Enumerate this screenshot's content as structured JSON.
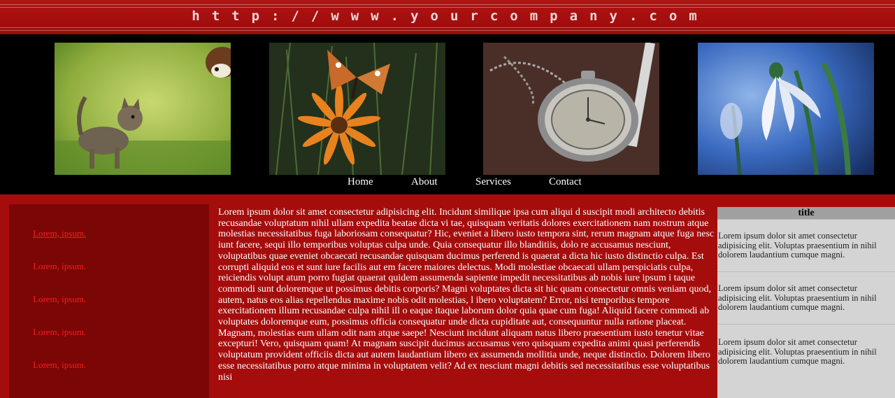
{
  "header": {
    "url_text": "http://www.yourcompany.com"
  },
  "gallery": {
    "images": [
      {
        "icon": "kitten-and-puppy-photo"
      },
      {
        "icon": "butterfly-on-flower-photo"
      },
      {
        "icon": "pocket-watch-photo"
      },
      {
        "icon": "snowdrop-flower-photo"
      }
    ]
  },
  "nav": {
    "items": [
      {
        "label": "Home"
      },
      {
        "label": "About"
      },
      {
        "label": "Services"
      },
      {
        "label": "Contact"
      }
    ]
  },
  "sidebar": {
    "links": [
      {
        "label": "Lorem, ipsum."
      },
      {
        "label": "Lorem, ipsum."
      },
      {
        "label": "Lorem, ipsum."
      },
      {
        "label": "Lorem, ipsum."
      },
      {
        "label": "Lorem, ipsum."
      }
    ]
  },
  "main": {
    "body": "Lorem ipsum dolor sit amet consectetur adipisicing elit. Incidunt similique ipsa cum aliqui d suscipit modi architecto debitis recusandae voluptatum nihil ullam expedita beatae dicta vi tae, quisquam veritatis dolores exercitationem nam nostrum atque molestias necessitatibus fuga laboriosam consequatur? Hic, eveniet a libero iusto tempora sint, rerum magnam atque fuga nesc iunt facere, sequi illo temporibus voluptas culpa unde. Quia consequatur illo blanditiis, dolo re accusamus nesciunt, voluptatibus quae eveniet obcaecati recusandae quisquam ducimus perferend is quaerat a dicta hic iusto distinctio culpa. Est corrupti aliquid eos et sunt iure facilis aut em facere maiores delectus. Modi molestiae obcaecati ullam perspiciatis culpa, reiciendis volupt atum porro fugiat quaerat quidem assumenda sapiente impedit necessitatibus ab nobis iure ipsum i taque commodi sunt doloremque ut possimus debitis corporis? Magni voluptates dicta sit hic quam consectetur omnis veniam quod, autem, natus eos alias repellendus maxime nobis odit molestias, l ibero voluptatem? Error, nisi temporibus tempore exercitationem illum recusandae culpa nihil ill o eaque itaque laborum dolor quia quae cum fuga! Aliquid facere commodi ab voluptates doloremque eum, possimus officia consequatur unde dicta cupiditate aut, consequuntur nulla ratione placeat. Magnam, molestias eum ullam odit nam atque saepe! Nesciunt incidunt aliquam natus libero praesentium iusto tenetur vitae excepturi! Vero, quisquam quam! At magnam suscipit ducimus accusamus vero quisquam expedita animi quasi perferendis voluptatum provident officiis dicta aut autem laudantium libero ex assumenda mollitia unde, neque distinctio. Dolorem libero esse necessitatibus porro atque minima in voluptatem velit? Ad ex nesciunt magni debitis sed necessitatibus esse voluptatibus nisi"
  },
  "aside": {
    "title": "title",
    "items": [
      {
        "text": "Lorem ipsum dolor sit amet consectetur adipisicing elit. Voluptas praesentium in nihil dolorem laudantium cumque magni."
      },
      {
        "text": "Lorem ipsum dolor sit amet consectetur adipisicing elit. Voluptas praesentium in nihil dolorem laudantium cumque magni."
      },
      {
        "text": "Lorem ipsum dolor sit amet consectetur adipisicing elit. Voluptas praesentium in nihil dolorem laudantium cumque magni."
      }
    ]
  },
  "colors": {
    "page_bg": "#a50d0d",
    "sidebar_bg": "#7b0606",
    "link_color": "#ff1a1a",
    "gallery_bg": "#000000",
    "aside_bg": "#d4d4d4",
    "aside_title_bg": "#a0a0a0"
  }
}
